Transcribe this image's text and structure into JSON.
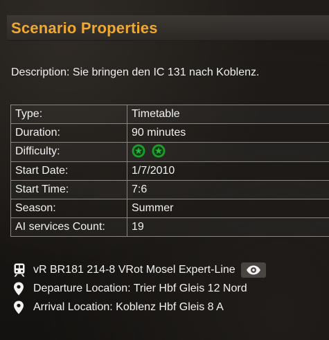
{
  "header": {
    "title": "Scenario Properties"
  },
  "description": "Description: Sie bringen den IC 131 nach Koblenz.",
  "properties": [
    {
      "label": "Type:",
      "value": "Timetable"
    },
    {
      "label": "Duration:",
      "value": "90 minutes"
    },
    {
      "label": "Difficulty:",
      "value": "",
      "stars": 2
    },
    {
      "label": "Start Date:",
      "value": "1/7/2010"
    },
    {
      "label": "Start Time:",
      "value": "7:6"
    },
    {
      "label": "Season:",
      "value": "Summer"
    },
    {
      "label": "AI services Count:",
      "value": "19"
    }
  ],
  "info": {
    "consist": {
      "icon": "train-icon",
      "text": "vR BR181 214-8 VRot Mosel Expert-Line"
    },
    "departure": {
      "icon": "map-pin-icon",
      "text": "Departure Location: Trier Hbf Gleis 12 Nord"
    },
    "arrival": {
      "icon": "map-pin-icon",
      "text": "Arrival Location: Koblenz Hbf Gleis 8 A"
    },
    "preview_icon": "eye-icon"
  },
  "colors": {
    "accent": "#f0a830",
    "star_green": "#1f9a2c",
    "border": "#8a8580"
  }
}
